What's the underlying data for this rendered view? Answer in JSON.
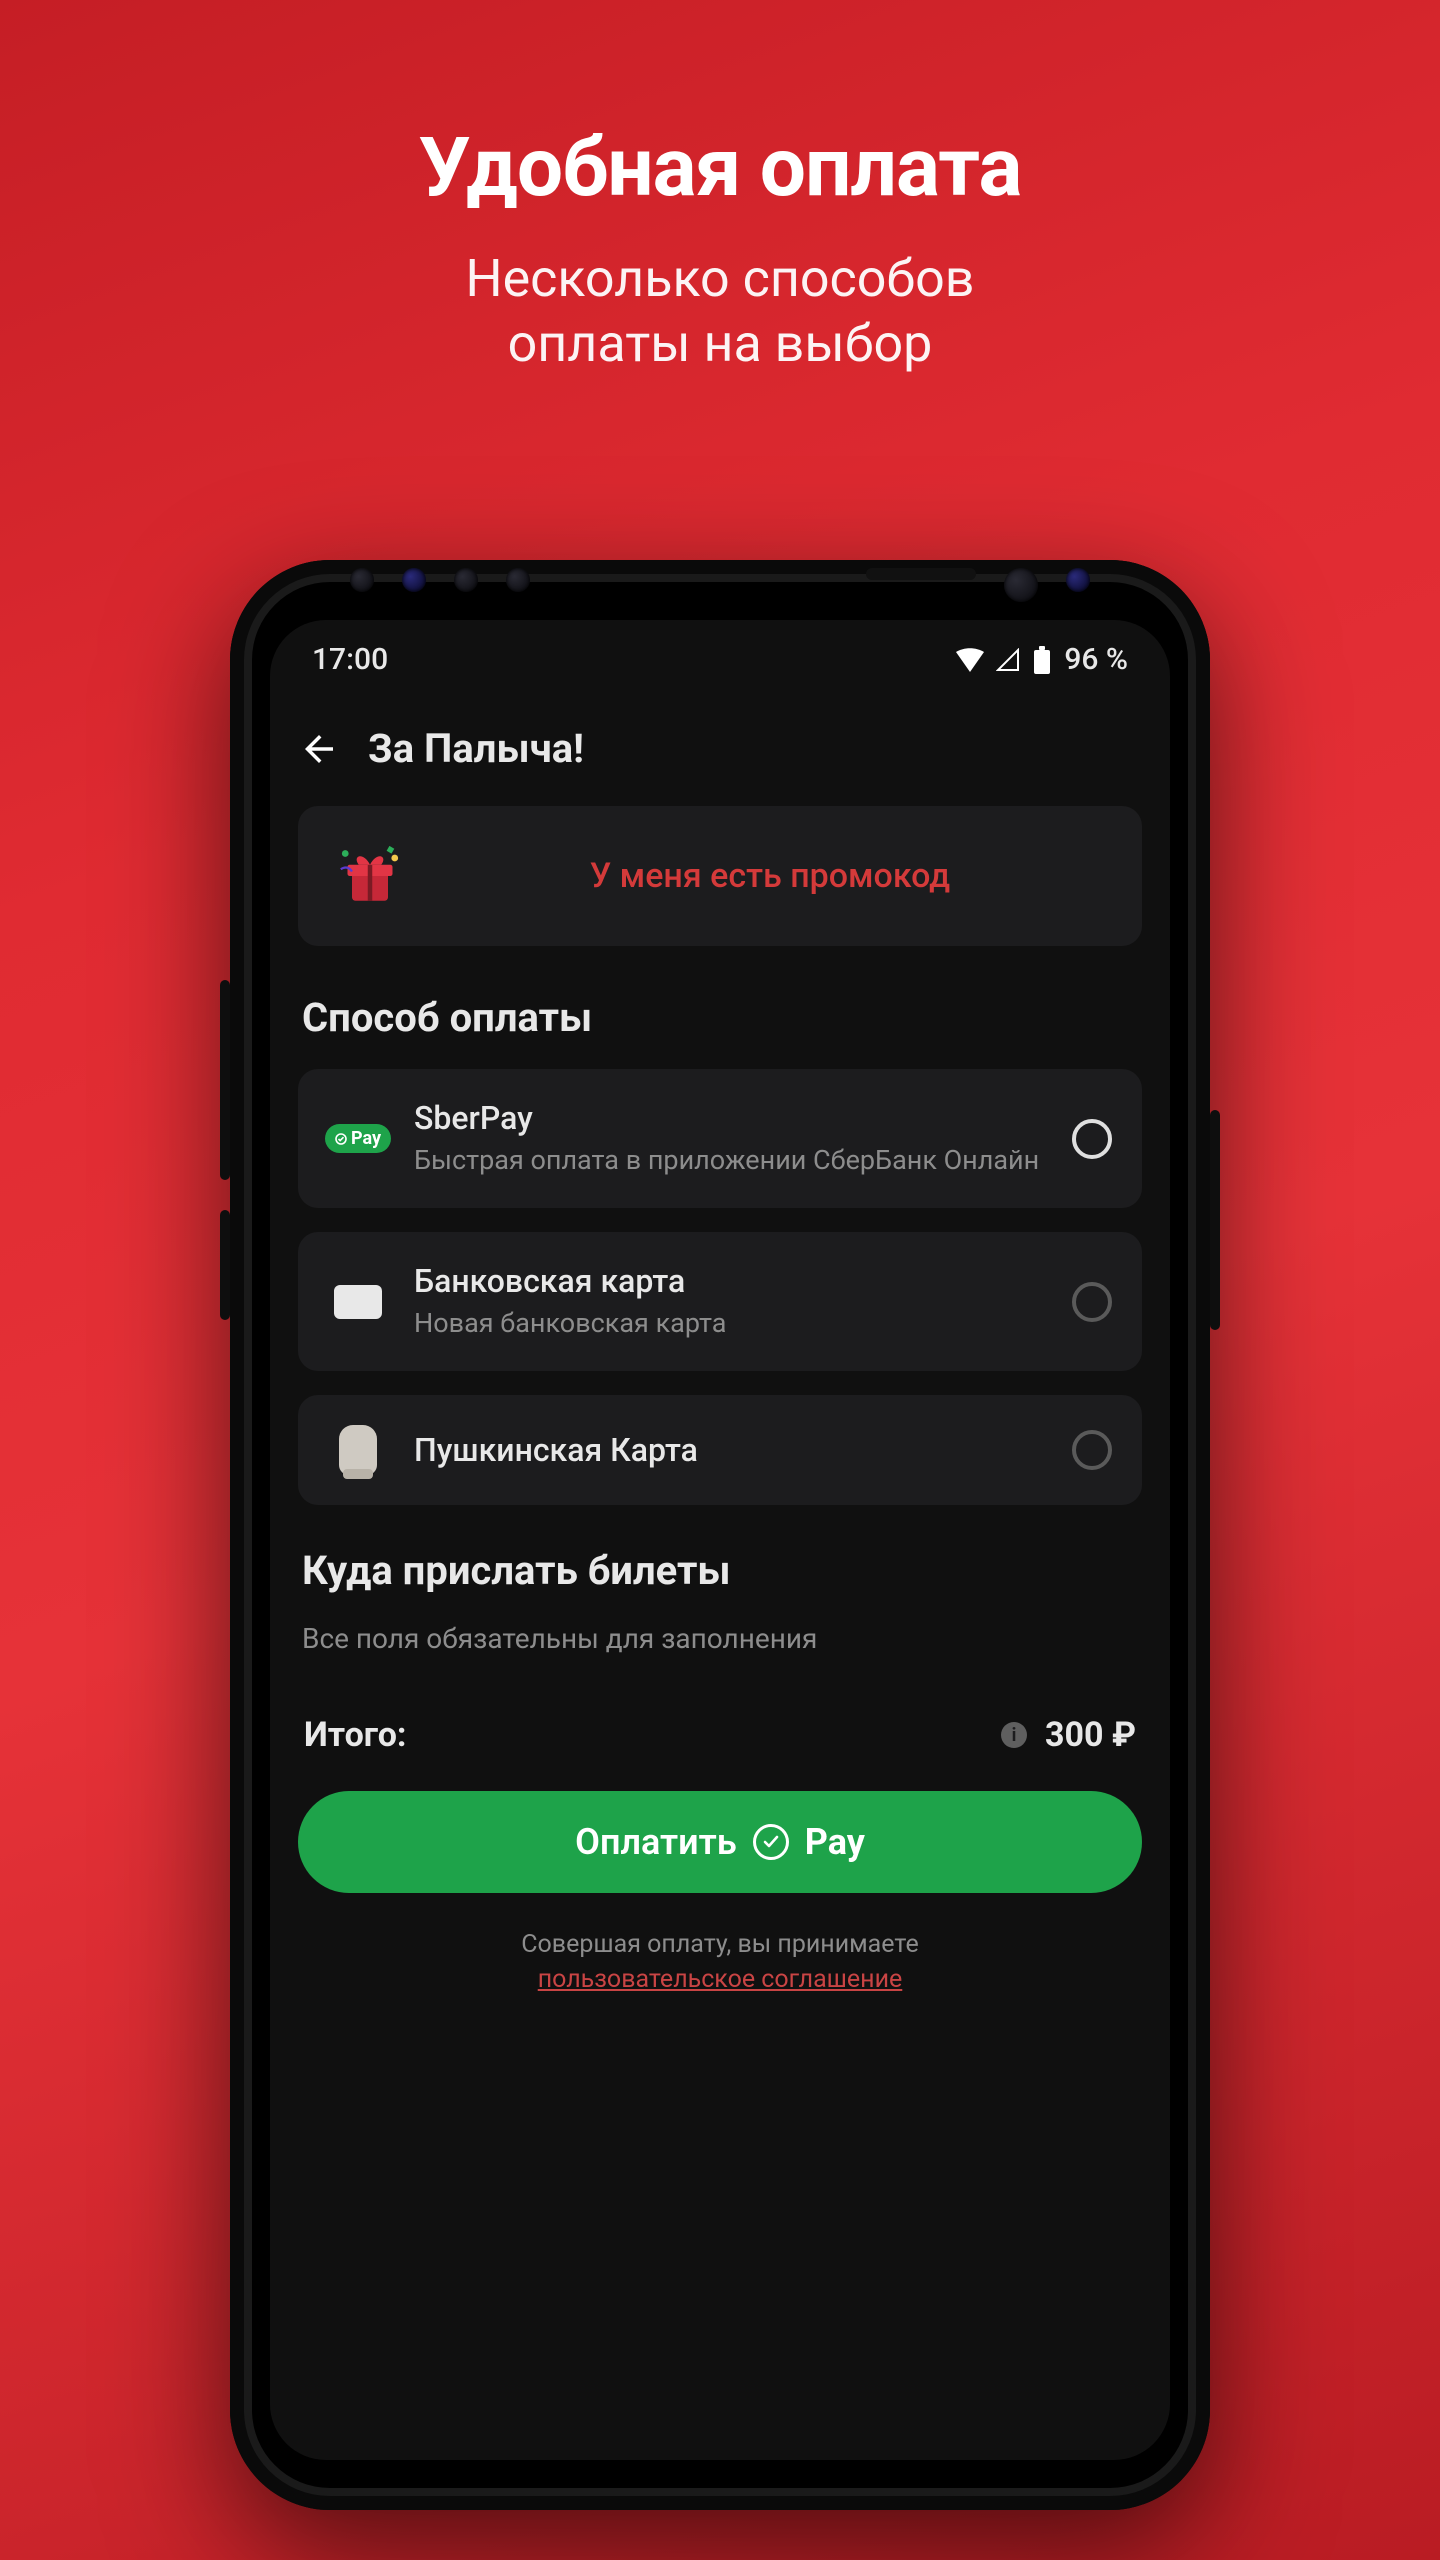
{
  "promo": {
    "title": "Удобная оплата",
    "subtitle1": "Несколько способов",
    "subtitle2": "оплаты на выбор"
  },
  "status": {
    "time": "17:00",
    "battery": "96 %"
  },
  "header": {
    "title": "За Палыча!"
  },
  "promoCode": {
    "label": "У меня есть промокод"
  },
  "payment": {
    "heading": "Способ оплаты",
    "options": [
      {
        "title": "SberPay",
        "desc": "Быстрая оплата в приложении СберБанк Онлайн",
        "selected": true,
        "badge": "Pay"
      },
      {
        "title": "Банковская карта",
        "desc": "Новая банковская карта",
        "selected": false
      },
      {
        "title": "Пушкинская Карта",
        "desc": "",
        "selected": false
      }
    ]
  },
  "delivery": {
    "heading": "Куда прислать билеты",
    "sub": "Все поля обязательны для заполнения"
  },
  "totals": {
    "label": "Итого:",
    "amount": "300 ₽"
  },
  "payButton": {
    "l1": "Оплатить",
    "l2": "Pay"
  },
  "legal": {
    "l1": "Совершая оплату, вы принимаете",
    "l2": "пользовательское соглашение"
  }
}
